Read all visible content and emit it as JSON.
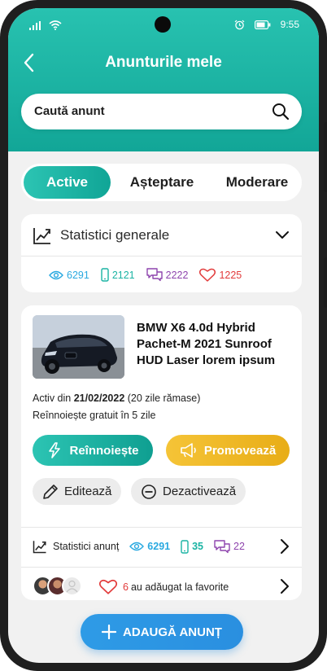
{
  "status_bar": {
    "time": "9:55"
  },
  "header": {
    "title": "Anunturile mele"
  },
  "search": {
    "placeholder": "Caută anunt"
  },
  "tabs": [
    {
      "label": "Active",
      "active": true
    },
    {
      "label": "Așteptare",
      "active": false
    },
    {
      "label": "Moderare",
      "active": false
    }
  ],
  "general_stats": {
    "label": "Statistici generale",
    "views": "6291",
    "phone": "2121",
    "messages": "2222",
    "favorites": "1225"
  },
  "ad": {
    "title": "BMW X6 4.0d Hybrid Pachet-M 2021 Sunroof HUD Laser lorem ipsum",
    "active_prefix": "Activ din ",
    "active_date": "21/02/2022",
    "active_suffix": " (20 zile rămase)",
    "renew_info": "Reînnoiește gratuit în 5 zile",
    "renew_label": "Reînnoiește",
    "promote_label": "Promovează",
    "edit_label": "Editează",
    "deactivate_label": "Dezactivează",
    "stats_label": "Statistici anunț",
    "views": "6291",
    "phone": "35",
    "messages": "22",
    "fav_count": "6",
    "fav_text": "au adăugat la favorite"
  },
  "fab": {
    "label": "ADAUGĂ ANUNȚ"
  },
  "colors": {
    "teal": "#1ab3a3",
    "blue": "#2aa9e0",
    "purple": "#8e44ad",
    "red": "#e23b3b",
    "yellow": "#f0b92a"
  }
}
